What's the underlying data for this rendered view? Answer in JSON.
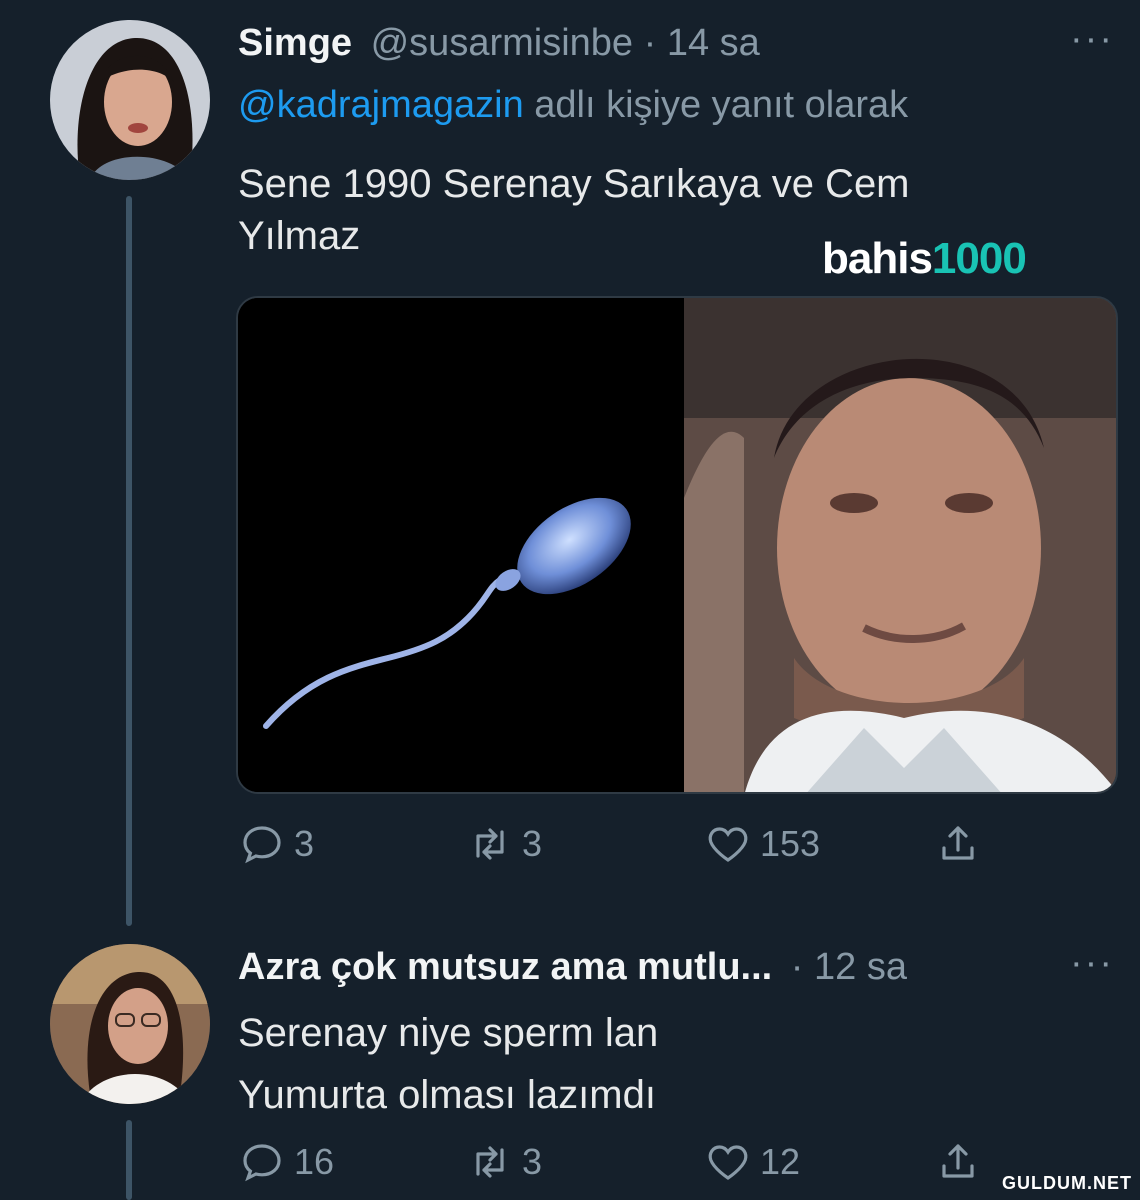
{
  "tweet1": {
    "name": "Simge",
    "handle": "@susarmisinbe",
    "separator": "·",
    "time": "14 sa",
    "more": "···",
    "reply_mention": "@kadrajmagazin",
    "reply_suffix": "adlı kişiye yanıt olarak",
    "text_line1": "Sene 1990 Serenay Sarıkaya ve Cem",
    "text_line2": "Yılmaz",
    "watermark_main": "bahis",
    "watermark_accent": "1000",
    "replies": "3",
    "retweets": "3",
    "likes": "153"
  },
  "tweet2": {
    "name": "Azra çok mutsuz ama mutlu...",
    "separator": "·",
    "time": "12 sa",
    "more": "···",
    "text_line1": "Serenay niye sperm lan",
    "text_line2": "Yumurta olması lazımdı",
    "replies": "16",
    "retweets": "3",
    "likes": "12"
  },
  "site_tag": "GULDUM.NET",
  "colors": {
    "background": "#15202b",
    "link": "#1d9bf0",
    "muted": "#8899a6",
    "thread_line": "#3d5466"
  }
}
